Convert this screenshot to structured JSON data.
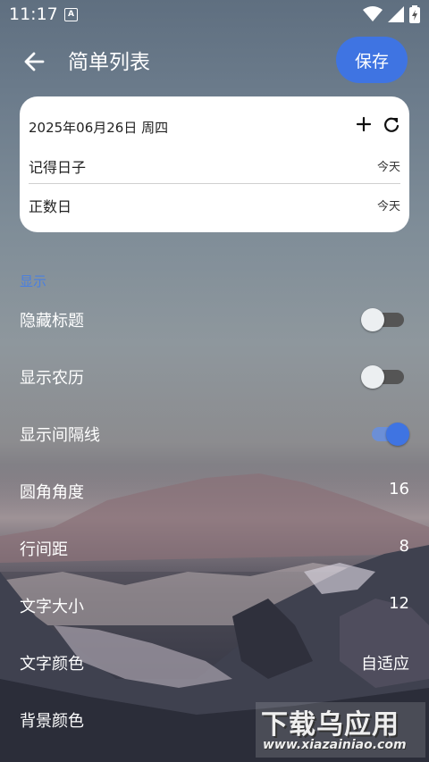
{
  "status_bar": {
    "time": "11:17",
    "notification_glyph": "A"
  },
  "app_bar": {
    "title": "简单列表",
    "save_label": "保存"
  },
  "card": {
    "date": "2025年06月26日 周四",
    "rows": [
      {
        "name": "记得日子",
        "value": "今天"
      },
      {
        "name": "正数日",
        "value": "今天"
      }
    ]
  },
  "section": {
    "label": "显示"
  },
  "settings": [
    {
      "label": "隐藏标题",
      "type": "toggle",
      "checked": false
    },
    {
      "label": "显示农历",
      "type": "toggle",
      "checked": false
    },
    {
      "label": "显示间隔线",
      "type": "toggle",
      "checked": true
    },
    {
      "label": "圆角角度",
      "type": "value",
      "value": "16"
    },
    {
      "label": "行间距",
      "type": "value",
      "value": "8"
    },
    {
      "label": "文字大小",
      "type": "value",
      "value": "12"
    },
    {
      "label": "文字颜色",
      "type": "value",
      "value": "自适应"
    },
    {
      "label": "背景颜色",
      "type": "value",
      "value": ""
    }
  ],
  "watermark": {
    "big": "下载乌应用",
    "small": "www.xiazainiao.com"
  },
  "colors": {
    "accent": "#3f74e2",
    "section_label": "#4a7fe0",
    "card_bg": "#ffffff"
  },
  "icons": [
    "back-arrow-icon",
    "plus-icon",
    "refresh-icon",
    "wifi-icon",
    "signal-icon",
    "battery-icon"
  ]
}
